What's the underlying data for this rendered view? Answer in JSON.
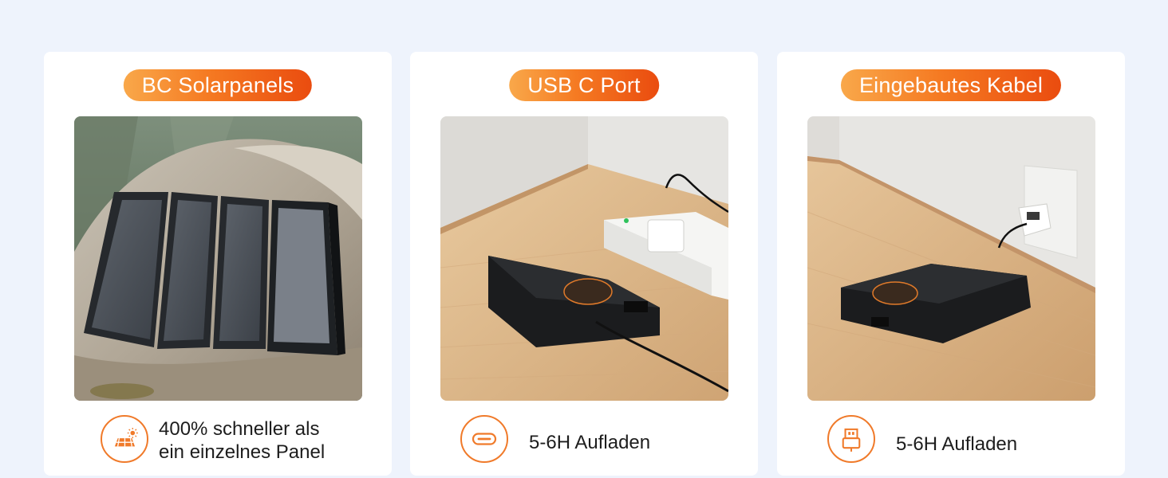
{
  "cards": [
    {
      "title": "BC Solarpanels",
      "feature_line1": "400% schneller als",
      "feature_line2": "ein einzelnes Panel",
      "icon": "solar-panel-icon"
    },
    {
      "title": "USB C Port",
      "feature": "5-6H Aufladen",
      "icon": "usb-c-port-icon"
    },
    {
      "title": "Eingebautes Kabel",
      "feature": "5-6H Aufladen",
      "icon": "usb-cable-icon"
    }
  ],
  "colors": {
    "background": "#eef3fc",
    "accent_start": "#f9a84a",
    "accent_end": "#ea4c0f",
    "icon_stroke": "#f07a2a"
  }
}
